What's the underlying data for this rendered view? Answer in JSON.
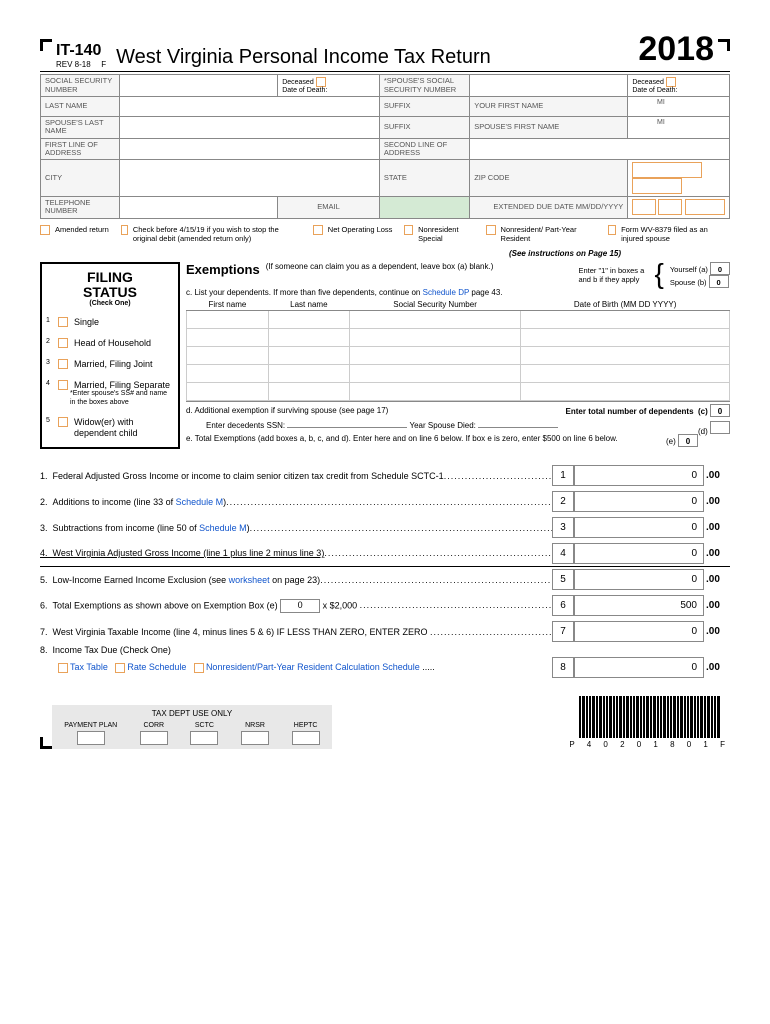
{
  "header": {
    "form_code": "IT-140",
    "revision": "REV 8-18",
    "type_code": "F",
    "title": "West Virginia Personal Income Tax Return",
    "year": "2018"
  },
  "id_labels": {
    "ssn": "SOCIAL SECURITY NUMBER",
    "deceased": "Deceased",
    "dod": "Date of Death:",
    "spouse_ssn": "*SPOUSE'S SOCIAL SECURITY NUMBER",
    "last_name": "LAST NAME",
    "suffix": "SUFFIX",
    "first_name": "YOUR FIRST NAME",
    "mi": "MI",
    "spouse_last": "SPOUSE'S LAST NAME",
    "spouse_first": "SPOUSE'S FIRST NAME",
    "addr1": "FIRST LINE OF ADDRESS",
    "addr2": "SECOND LINE OF ADDRESS",
    "city": "CITY",
    "state": "STATE",
    "zip": "ZIP CODE",
    "phone": "TELEPHONE NUMBER",
    "email": "EMAIL",
    "ext_due": "EXTENDED DUE DATE MM/DD/YYYY"
  },
  "checkboxes": {
    "amended": "Amended return",
    "stop_debit": "Check before 4/15/19 if you wish to stop the original debit (amended return only)",
    "nol": "Net Operating Loss",
    "nonres_special": "Nonresident Special",
    "nonres_part": "Nonresident/ Part-Year Resident",
    "wv8379": "Form WV-8379 filed as an injured spouse",
    "see_instr": "(See instructions on Page 15)"
  },
  "filing": {
    "title1": "FILING",
    "title2": "STATUS",
    "check_one": "(Check One)",
    "opts": [
      "Single",
      "Head of Household",
      "Married, Filing Joint",
      "Married, Filing Separate",
      "Widow(er) with dependent child"
    ],
    "sep_note": "*Enter spouse's SS# and name in the boxes above"
  },
  "exemptions": {
    "title": "Exemptions",
    "note": "(If someone can claim you as a dependent, leave box (a) blank.)",
    "enter1": "Enter \"1\" in boxes a and b if they apply",
    "yourself": "Yourself  (a)",
    "spouse": "Spouse  (b)",
    "val_a": "0",
    "val_b": "0",
    "list_note": "c. List your dependents. If more than five dependents, continue on ",
    "schedule_dp": "Schedule DP",
    "page43": " page 43.",
    "cols": [
      "First name",
      "Last name",
      "Social Security Number",
      "Date of Birth (MM DD YYYY)"
    ],
    "d_addl": "d. Additional exemption if surviving spouse (see page 17)",
    "enter_total": "Enter total number of dependents",
    "decedents": "Enter decedents SSN:",
    "year_died": "Year Spouse Died:",
    "e_total": "e. Total Exemptions (add boxes a, b, c, and d). Enter here and on line 6 below. If box e is zero, enter $500 on line 6 below.",
    "val_c": "0",
    "val_d": "",
    "val_e": "0"
  },
  "lines": [
    {
      "n": "1",
      "desc": "Federal Adjusted Gross Income or income to claim senior citizen tax credit from Schedule SCTC-1",
      "amt": "0"
    },
    {
      "n": "2",
      "desc": "Additions to income (line 33 of ",
      "link": "Schedule M",
      "tail": ")",
      "amt": "0"
    },
    {
      "n": "3",
      "desc": "Subtractions from income (line 50 of ",
      "link": "Schedule M",
      "tail": ")",
      "amt": "0"
    },
    {
      "n": "4",
      "desc": "West Virginia Adjusted Gross Income (line 1 plus line 2 minus line 3)",
      "amt": "0"
    },
    {
      "n": "5",
      "desc": "Low-Income Earned Income Exclusion (see ",
      "link": "worksheet",
      "tail": " on page 23)",
      "amt": "0"
    },
    {
      "n": "6",
      "desc": "Total Exemptions as shown above on Exemption Box (e) ",
      "box": "0",
      "tail2": " x $2,000 ",
      "amt": "500"
    },
    {
      "n": "7",
      "desc": "West Virginia Taxable Income (line 4, minus lines 5 & 6) IF LESS THAN ZERO, ENTER ZERO ",
      "amt": "0"
    },
    {
      "n": "8",
      "desc": "Income Tax Due (Check One)",
      "amt": "0"
    }
  ],
  "line8_opts": {
    "tax_table": "Tax Table",
    "rate_sched": "Rate Schedule",
    "nonres_calc": "Nonresident/Part-Year Resident Calculation Schedule"
  },
  "cents": ".00",
  "dept_use": {
    "title": "TAX DEPT USE ONLY",
    "cols": [
      "PAYMENT PLAN",
      "CORR",
      "SCTC",
      "NRSR",
      "HEPTC"
    ]
  },
  "barcode_text": "P 4 0 2 0 1 8 0 1 F"
}
